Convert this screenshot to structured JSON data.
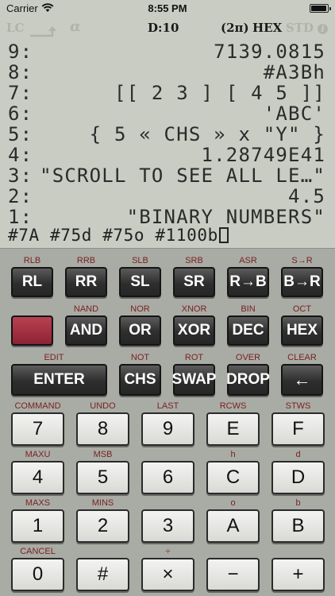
{
  "status_bar": {
    "carrier": "Carrier",
    "time": "8:55 PM",
    "battery_level": 0.95
  },
  "annunciators": {
    "lc": "LC",
    "alpha": "α",
    "directory": "D:10",
    "two_pi": "(2π)",
    "base": "HEX",
    "std": "STD",
    "info": "i"
  },
  "stack": [
    {
      "level": "9:",
      "value": "7139.0815"
    },
    {
      "level": "8:",
      "value": "#A3Bh"
    },
    {
      "level": "7:",
      "value": "[[ 2 3 ] [ 4 5 ]]"
    },
    {
      "level": "6:",
      "value": "'ABC'"
    },
    {
      "level": "5:",
      "value": "{ 5 « CHS » x \"Y\" }"
    },
    {
      "level": "4:",
      "value": "1.28749E41"
    },
    {
      "level": "3:",
      "value": "\"SCROLL TO SEE ALL LE…\""
    },
    {
      "level": "2:",
      "value": "4.5"
    },
    {
      "level": "1:",
      "value": "\"BINARY NUMBERS\""
    }
  ],
  "command_line": "#7A #75d #75o #1100b",
  "shift_labels": {
    "row1": [
      "RLB",
      "RRB",
      "SLB",
      "SRB",
      "ASR",
      "S→R"
    ],
    "row2": [
      "NAND",
      "NOR",
      "XNOR",
      "BIN",
      "OCT"
    ],
    "row3": [
      "EDIT",
      "NOT",
      "ROT",
      "OVER",
      "CLEAR"
    ],
    "row4": [
      "COMMAND",
      "UNDO",
      "LAST",
      "RCWS",
      "STWS"
    ],
    "row5": [
      "MAXU",
      "MSB",
      "h",
      "d"
    ],
    "row6": [
      "MAXS",
      "MINS",
      "o",
      "b"
    ],
    "row7": [
      "CANCEL",
      "÷"
    ]
  },
  "keys": {
    "row1": [
      "RL",
      "RR",
      "SL",
      "SR",
      "R→B",
      "B→R"
    ],
    "row2": [
      "AND",
      "OR",
      "XOR",
      "DEC",
      "HEX"
    ],
    "row3": [
      "ENTER",
      "CHS",
      "SWAP",
      "DROP",
      "←"
    ],
    "row4": [
      "7",
      "8",
      "9",
      "E",
      "F"
    ],
    "row5": [
      "4",
      "5",
      "6",
      "C",
      "D"
    ],
    "row6": [
      "1",
      "2",
      "3",
      "A",
      "B"
    ],
    "row7": [
      "0",
      "#",
      "×",
      "−",
      "+"
    ]
  },
  "colors": {
    "lcd_background": "#c9ccc2",
    "keyboard_background": "#a9aca4",
    "shift_label": "#7a1f24",
    "shift_key": "#a33447"
  }
}
